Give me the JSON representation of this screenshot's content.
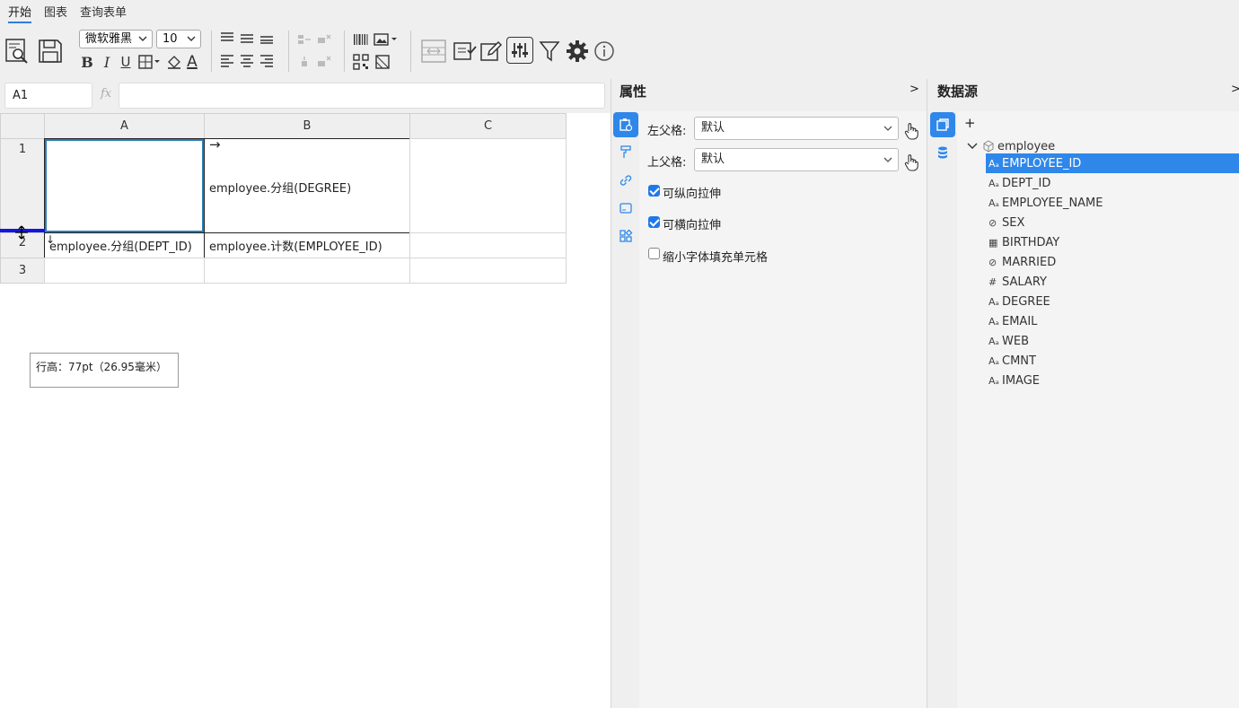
{
  "menu": {
    "tabs": [
      "开始",
      "图表",
      "查询表单"
    ]
  },
  "toolbar": {
    "font_family": "微软雅黑",
    "font_size": "10",
    "bold_label": "B",
    "italic_label": "I",
    "underline_label": "U",
    "font_color_label": "A"
  },
  "formula": {
    "cell_ref": "A1",
    "fx_label": "fx",
    "value": ""
  },
  "grid": {
    "columns": [
      "A",
      "B",
      "C"
    ],
    "rows": [
      "1",
      "2",
      "3"
    ],
    "cells": {
      "B1_arrow": "→",
      "B1": "employee.分组(DEGREE)",
      "A2_arrow": "↓",
      "A2": "employee.分组(DEPT_ID)",
      "B2": "employee.计数(EMPLOYEE_ID)"
    },
    "tooltip": "行高：77pt（26.95毫米）"
  },
  "properties": {
    "title": "属性",
    "toggle": ">",
    "left_parent_label": "左父格:",
    "left_parent_value": "默认",
    "top_parent_label": "上父格:",
    "top_parent_value": "默认",
    "options": [
      {
        "label": "可纵向拉伸",
        "checked": true
      },
      {
        "label": "可横向拉伸",
        "checked": true
      },
      {
        "label": "缩小字体填充单元格",
        "checked": false
      }
    ]
  },
  "datasource": {
    "title": "数据源",
    "toggle": ">",
    "add_label": "+",
    "root": "employee",
    "fields": [
      {
        "name": "EMPLOYEE_ID",
        "icon": "text-type-icon",
        "glyph": "Aₐ",
        "selected": true
      },
      {
        "name": "DEPT_ID",
        "icon": "text-type-icon",
        "glyph": "Aₐ"
      },
      {
        "name": "EMPLOYEE_NAME",
        "icon": "text-type-icon",
        "glyph": "Aₐ"
      },
      {
        "name": "SEX",
        "icon": "boolean-type-icon",
        "glyph": "⊘"
      },
      {
        "name": "BIRTHDAY",
        "icon": "date-type-icon",
        "glyph": "▦"
      },
      {
        "name": "MARRIED",
        "icon": "boolean-type-icon",
        "glyph": "⊘"
      },
      {
        "name": "SALARY",
        "icon": "number-type-icon",
        "glyph": "#"
      },
      {
        "name": "DEGREE",
        "icon": "text-type-icon",
        "glyph": "Aₐ"
      },
      {
        "name": "EMAIL",
        "icon": "text-type-icon",
        "glyph": "Aₐ"
      },
      {
        "name": "WEB",
        "icon": "text-type-icon",
        "glyph": "Aₐ"
      },
      {
        "name": "CMNT",
        "icon": "text-type-icon",
        "glyph": "Aₐ"
      },
      {
        "name": "IMAGE",
        "icon": "text-type-icon",
        "glyph": "Aₐ"
      }
    ]
  },
  "colors": {
    "accent": "#2f87ea",
    "row_resize_line": "#1515e0"
  }
}
